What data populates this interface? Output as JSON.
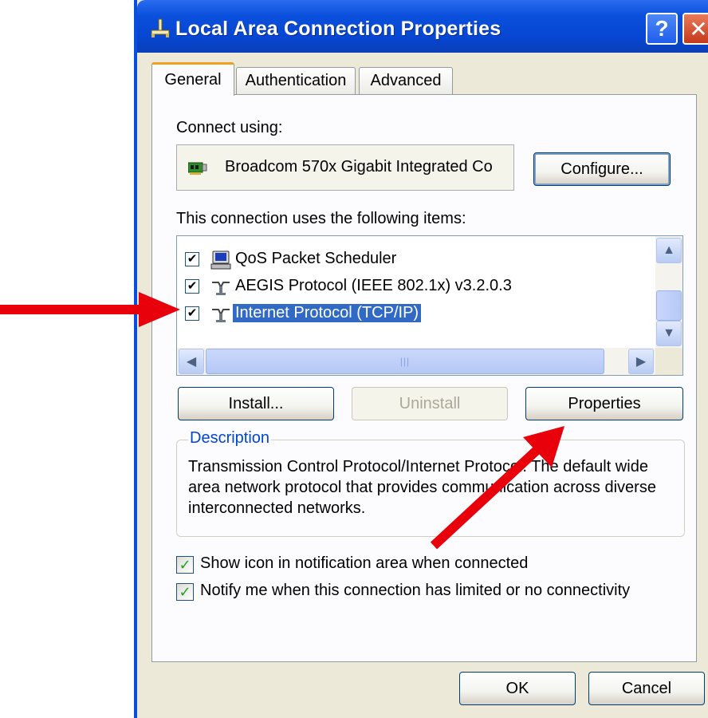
{
  "window": {
    "title": "Local Area Connection Properties",
    "help_label": "?",
    "close_label": "✕"
  },
  "tabs": [
    {
      "label": "General",
      "selected": true
    },
    {
      "label": "Authentication",
      "selected": false
    },
    {
      "label": "Advanced",
      "selected": false
    }
  ],
  "general": {
    "connect_using_label": "Connect using:",
    "adapter_name": "Broadcom 570x Gigabit Integrated Co",
    "configure_button": "Configure...",
    "items_label": "This connection uses the following items:",
    "items": [
      {
        "label": "QoS Packet Scheduler",
        "checked": true,
        "icon": "scheduler-icon",
        "selected": false
      },
      {
        "label": "AEGIS Protocol (IEEE 802.1x) v3.2.0.3",
        "checked": true,
        "icon": "network-protocol-icon",
        "selected": false
      },
      {
        "label": "Internet Protocol (TCP/IP)",
        "checked": true,
        "icon": "network-protocol-icon",
        "selected": true
      }
    ],
    "install_button": "Install...",
    "uninstall_button": "Uninstall",
    "properties_button": "Properties",
    "description_title": "Description",
    "description_text": "Transmission Control Protocol/Internet Protocol. The default wide area network protocol that provides communication across diverse interconnected networks.",
    "show_icon_label": "Show icon in notification area when connected",
    "show_icon_checked": true,
    "notify_label": "Notify me when this connection has limited or no connectivity",
    "notify_checked": true
  },
  "footer": {
    "ok_button": "OK",
    "cancel_button": "Cancel"
  },
  "annotations": {
    "arrow_color": "#E8000B"
  },
  "colors": {
    "titlebar": "#0A50DC",
    "dialog_bg": "#ECE9D8",
    "selection": "#316AC5",
    "group_title": "#0046D5"
  }
}
